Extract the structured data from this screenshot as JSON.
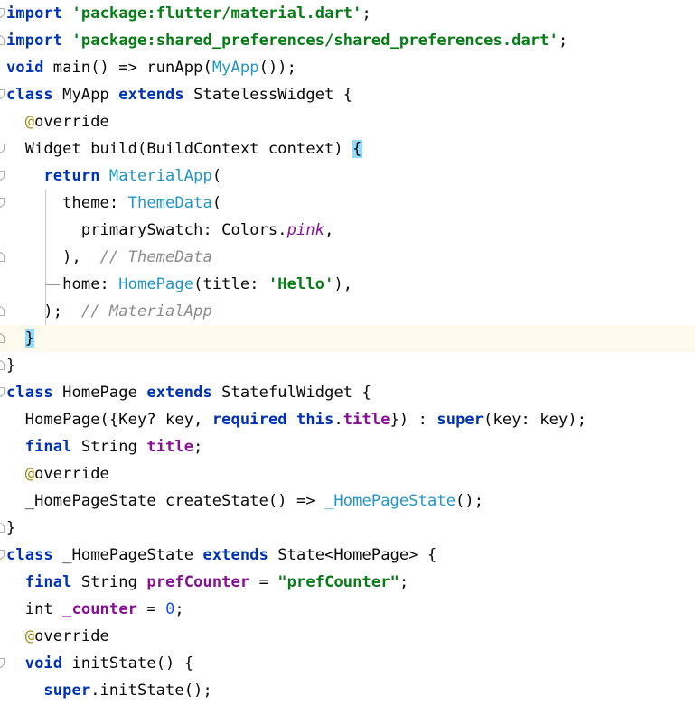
{
  "editor": {
    "language": "dart",
    "current_line_index": 12,
    "lines": [
      {
        "fold": "start",
        "tokens": [
          {
            "t": "import",
            "c": "kw"
          },
          {
            "t": " ",
            "c": ""
          },
          {
            "t": "'package:flutter/material.dart'",
            "c": "str"
          },
          {
            "t": ";",
            "c": ""
          }
        ]
      },
      {
        "fold": "end",
        "tokens": [
          {
            "t": "import",
            "c": "kw"
          },
          {
            "t": " ",
            "c": ""
          },
          {
            "t": "'package:shared_preferences/shared_preferences.dart'",
            "c": "str"
          },
          {
            "t": ";",
            "c": ""
          }
        ]
      },
      {
        "fold": "",
        "tokens": [
          {
            "t": "void",
            "c": "kw"
          },
          {
            "t": " main() => runApp(",
            "c": ""
          },
          {
            "t": "MyApp",
            "c": "cls"
          },
          {
            "t": "());",
            "c": ""
          }
        ]
      },
      {
        "fold": "start",
        "tokens": [
          {
            "t": "class",
            "c": "kw"
          },
          {
            "t": " MyApp ",
            "c": ""
          },
          {
            "t": "extends",
            "c": "kw"
          },
          {
            "t": " StatelessWidget {",
            "c": ""
          }
        ]
      },
      {
        "fold": "",
        "tokens": [
          {
            "t": "  ",
            "c": ""
          },
          {
            "t": "@",
            "c": "ann"
          },
          {
            "t": "override",
            "c": ""
          }
        ]
      },
      {
        "fold": "start",
        "tokens": [
          {
            "t": "  Widget build(BuildContext context) ",
            "c": ""
          },
          {
            "t": "{",
            "c": "brace-hl"
          }
        ]
      },
      {
        "fold": "start",
        "tokens": [
          {
            "t": "    ",
            "c": ""
          },
          {
            "t": "return",
            "c": "kw"
          },
          {
            "t": " ",
            "c": ""
          },
          {
            "t": "MaterialApp",
            "c": "cls"
          },
          {
            "t": "(",
            "c": ""
          }
        ]
      },
      {
        "fold": "start",
        "tokens": [
          {
            "t": "      theme: ",
            "c": ""
          },
          {
            "t": "ThemeData",
            "c": "cls"
          },
          {
            "t": "(",
            "c": ""
          }
        ]
      },
      {
        "fold": "",
        "tokens": [
          {
            "t": "        primarySwatch: Colors.",
            "c": ""
          },
          {
            "t": "pink",
            "c": "const"
          },
          {
            "t": ",",
            "c": ""
          }
        ]
      },
      {
        "fold": "end",
        "tokens": [
          {
            "t": "      ),  ",
            "c": ""
          },
          {
            "t": "// ThemeData",
            "c": "cmt"
          }
        ]
      },
      {
        "fold": "",
        "tokens": [
          {
            "t": "      home: ",
            "c": ""
          },
          {
            "t": "HomePage",
            "c": "cls"
          },
          {
            "t": "(title: ",
            "c": ""
          },
          {
            "t": "'Hello'",
            "c": "str"
          },
          {
            "t": "),",
            "c": ""
          }
        ]
      },
      {
        "fold": "end",
        "tokens": [
          {
            "t": "    );  ",
            "c": ""
          },
          {
            "t": "// MaterialApp",
            "c": "cmt"
          }
        ]
      },
      {
        "fold": "end",
        "tokens": [
          {
            "t": "  ",
            "c": ""
          },
          {
            "t": "}",
            "c": "brace-hl"
          }
        ]
      },
      {
        "fold": "end",
        "tokens": [
          {
            "t": "}",
            "c": ""
          }
        ]
      },
      {
        "fold": "start",
        "tokens": [
          {
            "t": "class",
            "c": "kw"
          },
          {
            "t": " HomePage ",
            "c": ""
          },
          {
            "t": "extends",
            "c": "kw"
          },
          {
            "t": " StatefulWidget {",
            "c": ""
          }
        ]
      },
      {
        "fold": "",
        "tokens": [
          {
            "t": "  HomePage({Key? key, ",
            "c": ""
          },
          {
            "t": "required",
            "c": "kw"
          },
          {
            "t": " ",
            "c": ""
          },
          {
            "t": "this",
            "c": "kw"
          },
          {
            "t": ".",
            "c": ""
          },
          {
            "t": "title",
            "c": "fld"
          },
          {
            "t": "}) : ",
            "c": ""
          },
          {
            "t": "super",
            "c": "kw"
          },
          {
            "t": "(key: key);",
            "c": ""
          }
        ]
      },
      {
        "fold": "",
        "tokens": [
          {
            "t": "  ",
            "c": ""
          },
          {
            "t": "final",
            "c": "kw"
          },
          {
            "t": " String ",
            "c": ""
          },
          {
            "t": "title",
            "c": "fld"
          },
          {
            "t": ";",
            "c": ""
          }
        ]
      },
      {
        "fold": "",
        "tokens": [
          {
            "t": "  ",
            "c": ""
          },
          {
            "t": "@",
            "c": "ann"
          },
          {
            "t": "override",
            "c": ""
          }
        ]
      },
      {
        "fold": "",
        "tokens": [
          {
            "t": "  _HomePageState createState() => ",
            "c": ""
          },
          {
            "t": "_HomePageState",
            "c": "cls"
          },
          {
            "t": "();",
            "c": ""
          }
        ]
      },
      {
        "fold": "end",
        "tokens": [
          {
            "t": "}",
            "c": ""
          }
        ]
      },
      {
        "fold": "start",
        "tokens": [
          {
            "t": "class",
            "c": "kw"
          },
          {
            "t": " _HomePageState ",
            "c": ""
          },
          {
            "t": "extends",
            "c": "kw"
          },
          {
            "t": " State<HomePage> {",
            "c": ""
          }
        ]
      },
      {
        "fold": "",
        "tokens": [
          {
            "t": "  ",
            "c": ""
          },
          {
            "t": "final",
            "c": "kw"
          },
          {
            "t": " String ",
            "c": ""
          },
          {
            "t": "prefCounter",
            "c": "fld"
          },
          {
            "t": " = ",
            "c": ""
          },
          {
            "t": "\"prefCounter\"",
            "c": "str"
          },
          {
            "t": ";",
            "c": ""
          }
        ]
      },
      {
        "fold": "",
        "tokens": [
          {
            "t": "  int ",
            "c": ""
          },
          {
            "t": "_counter",
            "c": "fld"
          },
          {
            "t": " = ",
            "c": ""
          },
          {
            "t": "0",
            "c": "num"
          },
          {
            "t": ";",
            "c": ""
          }
        ]
      },
      {
        "fold": "",
        "tokens": [
          {
            "t": "  ",
            "c": ""
          },
          {
            "t": "@",
            "c": "ann"
          },
          {
            "t": "override",
            "c": ""
          }
        ]
      },
      {
        "fold": "start",
        "tokens": [
          {
            "t": "  ",
            "c": ""
          },
          {
            "t": "void",
            "c": "kw"
          },
          {
            "t": " initState() {",
            "c": ""
          }
        ]
      },
      {
        "fold": "",
        "tokens": [
          {
            "t": "    ",
            "c": ""
          },
          {
            "t": "super",
            "c": "kw"
          },
          {
            "t": ".initState();",
            "c": ""
          }
        ]
      }
    ]
  }
}
